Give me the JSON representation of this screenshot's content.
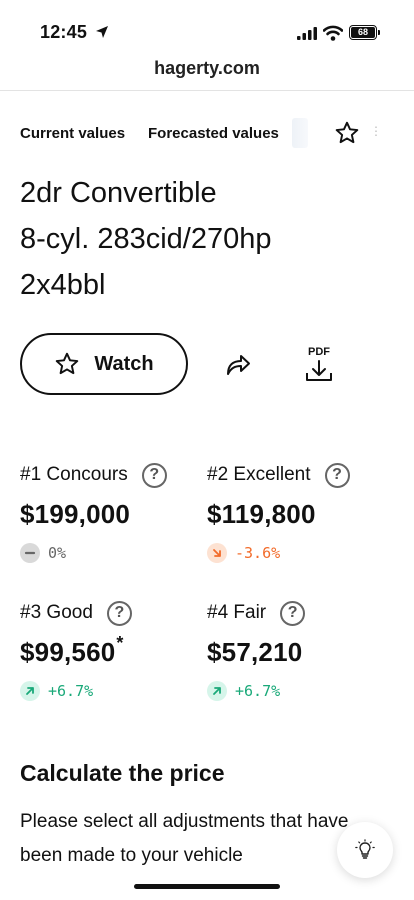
{
  "status_bar": {
    "time": "12:45",
    "battery": "68"
  },
  "browser": {
    "url": "hagerty.com"
  },
  "tabs": [
    {
      "label": "Current values"
    },
    {
      "label": "Forecasted values"
    }
  ],
  "vehicle": {
    "title_line1": "2dr Convertible",
    "title_line2": "8-cyl. 283cid/270hp",
    "title_line3": "2x4bbl"
  },
  "actions": {
    "watch_label": "Watch",
    "pdf_label": "PDF"
  },
  "values": [
    {
      "label": "#1 Concours",
      "price": "$199,000",
      "footnote": "",
      "change": "0%",
      "trend": "neutral"
    },
    {
      "label": "#2 Excellent",
      "price": "$119,800",
      "footnote": "",
      "change": "-3.6%",
      "trend": "down"
    },
    {
      "label": "#3 Good",
      "price": "$99,560",
      "footnote": "*",
      "change": "+6.7%",
      "trend": "up"
    },
    {
      "label": "#4 Fair",
      "price": "$57,210",
      "footnote": "",
      "change": "+6.7%",
      "trend": "up"
    }
  ],
  "help_glyph": "?",
  "calculator": {
    "title": "Calculate the price",
    "description": "Please select all adjustments that have been made to your vehicle"
  },
  "colors": {
    "down": "#f26b2a",
    "up": "#1aa979",
    "neutral": "#666666"
  },
  "icons": [
    "location-arrow-icon",
    "signal-icon",
    "wifi-icon",
    "battery-icon",
    "star-icon",
    "share-icon",
    "download-icon",
    "question-icon",
    "trend-icon",
    "lightbulb-icon"
  ]
}
